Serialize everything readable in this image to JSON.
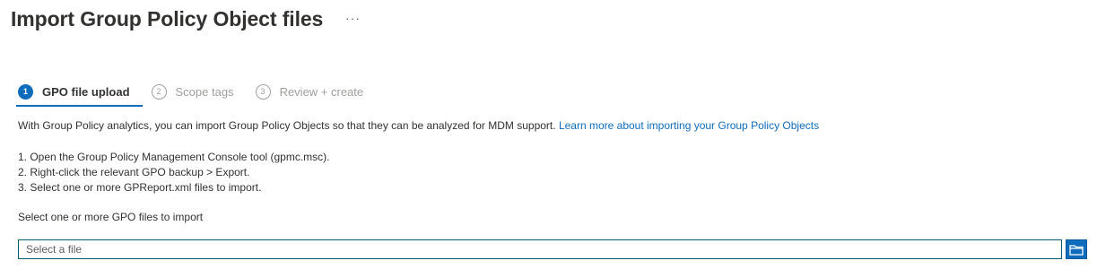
{
  "header": {
    "title": "Import Group Policy Object files",
    "more_label": "···"
  },
  "wizard": {
    "steps": [
      {
        "number": "1",
        "label": "GPO file upload",
        "state": "active"
      },
      {
        "number": "2",
        "label": "Scope tags",
        "state": "inactive"
      },
      {
        "number": "3",
        "label": "Review + create",
        "state": "inactive"
      }
    ]
  },
  "content": {
    "description": "With Group Policy analytics, you can import Group Policy Objects so that they can be analyzed for MDM support.",
    "learn_more_link": "Learn more about importing your Group Policy Objects",
    "instructions": [
      "1. Open the Group Policy Management Console tool (gpmc.msc).",
      "2. Right-click the relevant GPO backup > Export.",
      "3. Select one or more GPReport.xml files to import."
    ],
    "select_label": "Select one or more GPO files to import",
    "file_input": {
      "placeholder": "Select a file",
      "value": ""
    },
    "browse_icon": "folder-icon"
  },
  "colors": {
    "accent": "#0f6cbd",
    "text": "#323130",
    "muted": "#a19f9d",
    "input_border": "#005b70"
  }
}
